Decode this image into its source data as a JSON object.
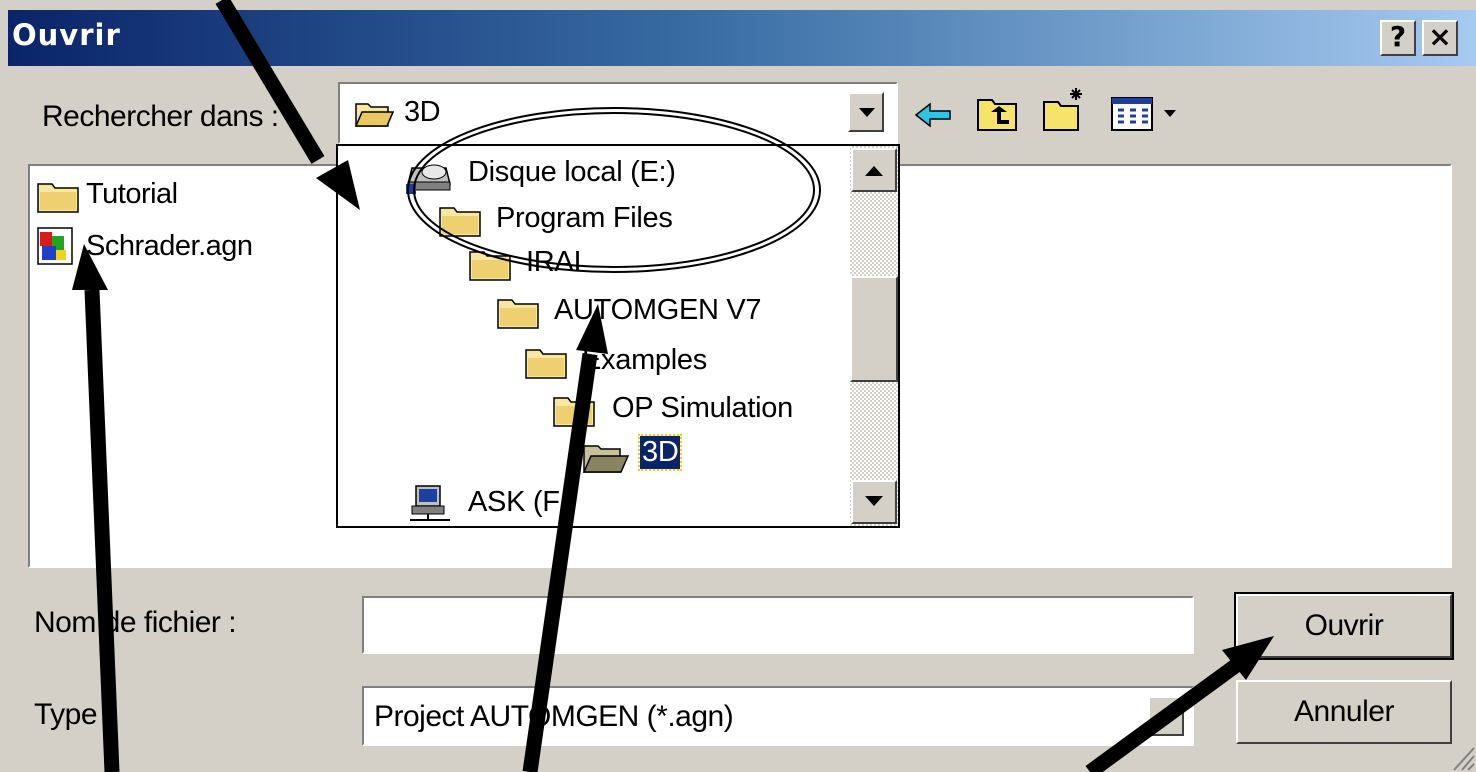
{
  "dialog": {
    "title": "Ouvrir",
    "help_button": "?",
    "close_button": "×"
  },
  "look_in": {
    "label": "Rechercher dans :",
    "value": "3D"
  },
  "toolbar": {
    "icons": [
      "back-arrow-icon",
      "up-folder-icon",
      "new-folder-icon",
      "view-menu-icon"
    ]
  },
  "file_list": {
    "items": [
      {
        "name": "Tutorial",
        "icon": "folder-icon"
      },
      {
        "name": "Schrader.agn",
        "icon": "agn-file-icon"
      }
    ]
  },
  "dropdown": {
    "items": [
      {
        "label": "Disque local (E:)",
        "icon": "drive-icon"
      },
      {
        "label": "Program Files",
        "icon": "folder-icon"
      },
      {
        "label": "IRAI",
        "icon": "folder-icon"
      },
      {
        "label": "AUTOMGEN V7",
        "icon": "folder-icon"
      },
      {
        "label": "Examples",
        "icon": "folder-icon"
      },
      {
        "label": "OP Simulation",
        "icon": "folder-icon"
      },
      {
        "label": "3D",
        "icon": "open-folder-icon",
        "selected": true
      },
      {
        "label": "ASK (F:)",
        "icon": "network-drive-icon"
      }
    ]
  },
  "filename": {
    "label": "Nom de fichier :",
    "value": ""
  },
  "filetype": {
    "label": "Type :",
    "value": "Project AUTOMGEN (*.agn)"
  },
  "buttons": {
    "open": "Ouvrir",
    "cancel": "Annuler"
  },
  "colors": {
    "title_gradient_start": "#0a246a",
    "title_gradient_end": "#a6caf0",
    "face": "#d4d0c8",
    "selection": "#0a246a"
  }
}
